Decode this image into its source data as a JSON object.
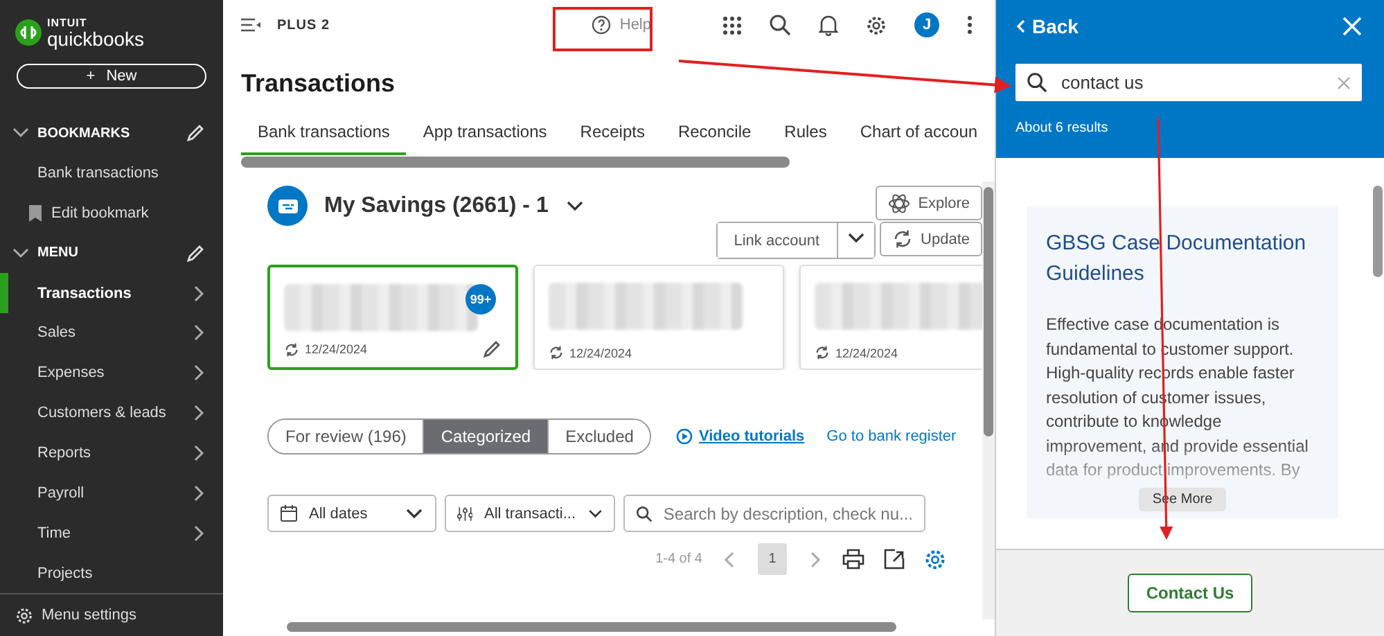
{
  "sidebar": {
    "logo": {
      "brand": "INTUIT",
      "product": "quickbooks"
    },
    "new_button": {
      "icon": "+",
      "label": "New"
    },
    "sections": [
      {
        "title": "BOOKMARKS",
        "expanded": true,
        "items": [
          {
            "label": "Bank transactions",
            "kind": "link",
            "selected": false,
            "submenu": false
          },
          {
            "label": "Edit bookmark",
            "kind": "bookmark",
            "selected": false,
            "submenu": false
          }
        ]
      },
      {
        "title": "MENU",
        "expanded": true,
        "items": [
          {
            "label": "Transactions",
            "kind": "link",
            "selected": true,
            "submenu": true
          },
          {
            "label": "Sales",
            "kind": "link",
            "selected": false,
            "submenu": true
          },
          {
            "label": "Expenses",
            "kind": "link",
            "selected": false,
            "submenu": true
          },
          {
            "label": "Customers & leads",
            "kind": "link",
            "selected": false,
            "submenu": true
          },
          {
            "label": "Reports",
            "kind": "link",
            "selected": false,
            "submenu": true
          },
          {
            "label": "Payroll",
            "kind": "link",
            "selected": false,
            "submenu": true
          },
          {
            "label": "Time",
            "kind": "link",
            "selected": false,
            "submenu": true
          },
          {
            "label": "Projects",
            "kind": "link",
            "selected": false,
            "submenu": false
          }
        ]
      }
    ],
    "settings": "Menu settings"
  },
  "topbar": {
    "plan": "PLUS 2",
    "help": "Help",
    "avatar": "J"
  },
  "page": {
    "title": "Transactions",
    "tabs": [
      {
        "label": "Bank transactions",
        "selected": true
      },
      {
        "label": "App transactions",
        "selected": false
      },
      {
        "label": "Receipts",
        "selected": false
      },
      {
        "label": "Reconcile",
        "selected": false
      },
      {
        "label": "Rules",
        "selected": false
      },
      {
        "label": "Chart of accoun",
        "selected": false
      }
    ]
  },
  "account": {
    "name": "My Savings (2661) - 1",
    "explore": "Explore",
    "link_account": "Link account",
    "update": "Update"
  },
  "cards": [
    {
      "badge": "99+",
      "date": "12/24/2024",
      "selected": true,
      "editable": true
    },
    {
      "date": "12/24/2024",
      "selected": false,
      "editable": false
    },
    {
      "date": "12/24/2024",
      "selected": false,
      "editable": false
    }
  ],
  "segments": [
    {
      "label": "For review (196)",
      "selected": false
    },
    {
      "label": "Categorized",
      "selected": true
    },
    {
      "label": "Excluded",
      "selected": false
    }
  ],
  "links": {
    "video": "Video tutorials",
    "register": "Go to bank register"
  },
  "filters": {
    "dates": "All dates",
    "types": "All transacti...",
    "search_placeholder": "Search by description, check nu..."
  },
  "pagination": {
    "range": "1-4 of 4",
    "page": "1"
  },
  "help_panel": {
    "back": "Back",
    "search_value": "contact us",
    "results": "About 6 results",
    "article": {
      "title": "GBSG Case Documentation Guidelines",
      "body": "Effective case documentation is fundamental to customer support. High-quality records enable faster resolution of customer issues, contribute to knowledge improvement, and provide essential data for product improvements. By",
      "more": "See More"
    },
    "contact": "Contact Us"
  }
}
